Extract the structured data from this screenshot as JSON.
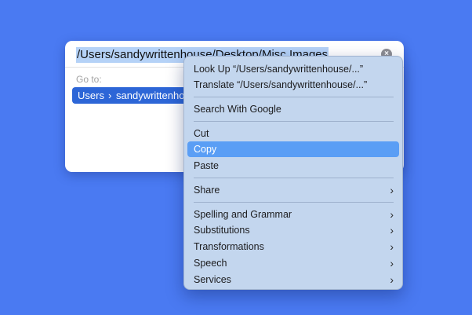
{
  "dialog": {
    "path_value": "/Users/sandywrittenhouse/Desktop/Misc Images",
    "clear_icon": "×",
    "goto_label": "Go to:",
    "suggestion": {
      "segment_1": "Users",
      "separator": "›",
      "segment_2": "sandywrittenho"
    }
  },
  "context_menu": {
    "look_up": "Look Up “/Users/sandywrittenhouse/...”",
    "translate": "Translate “/Users/sandywrittenhouse/...”",
    "search_google": "Search With Google",
    "cut": "Cut",
    "copy": "Copy",
    "paste": "Paste",
    "share": "Share",
    "spelling_grammar": "Spelling and Grammar",
    "substitutions": "Substitutions",
    "transformations": "Transformations",
    "speech": "Speech",
    "services": "Services",
    "chevron": "›",
    "selected_item": "Copy"
  },
  "colors": {
    "background": "#4a7af2",
    "selection_highlight": "#b5d2f7",
    "suggestion_bg": "#2d66d7",
    "menu_selected": "#5a9ef5"
  }
}
